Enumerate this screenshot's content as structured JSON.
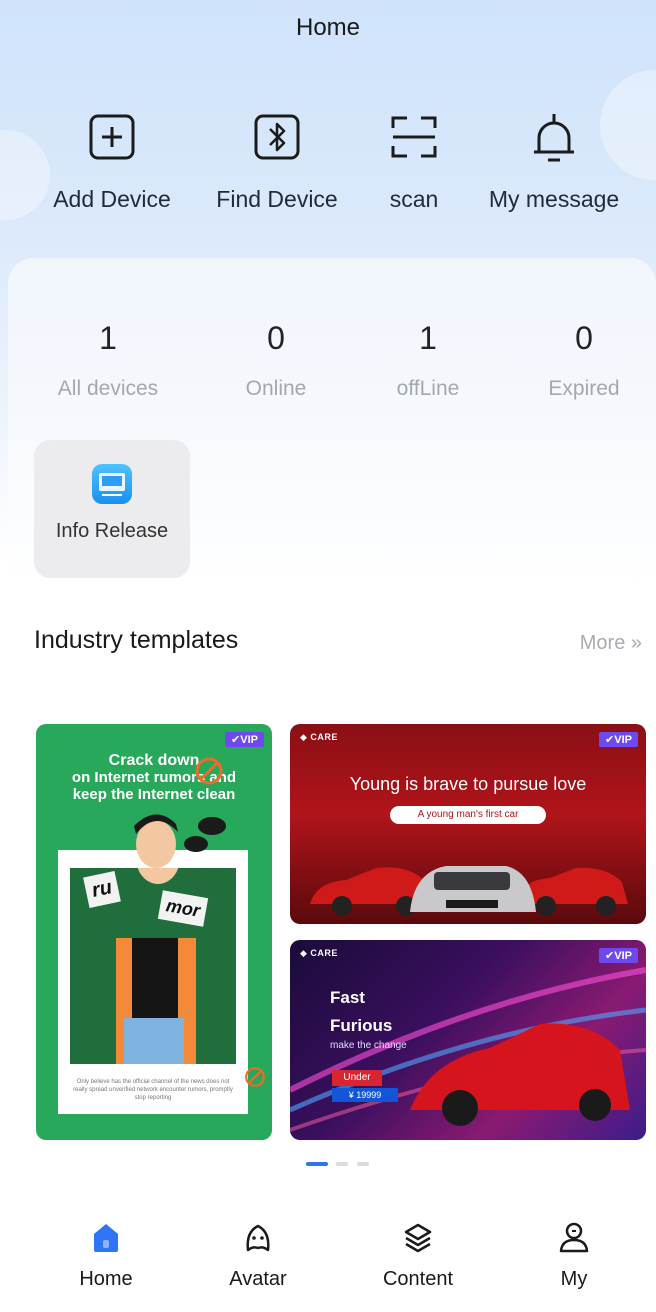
{
  "header": {
    "title": "Home"
  },
  "quick_actions": [
    {
      "label": "Add Device",
      "icon": "add-square-icon"
    },
    {
      "label": "Find Device",
      "icon": "bluetooth-icon"
    },
    {
      "label": "scan",
      "icon": "scan-icon"
    },
    {
      "label": "My message",
      "icon": "bell-icon"
    }
  ],
  "stats": [
    {
      "value": "1",
      "label": "All devices"
    },
    {
      "value": "0",
      "label": "Online"
    },
    {
      "value": "1",
      "label": "offLine"
    },
    {
      "value": "0",
      "label": "Expired"
    }
  ],
  "apps": [
    {
      "label": "Info Release",
      "icon": "info-release-icon"
    }
  ],
  "templates_section": {
    "title": "Industry templates",
    "more_label": "More »",
    "cards": [
      {
        "vip": "✔VIP",
        "headline_1": "Crack down",
        "headline_2": "on Internet rumors and",
        "headline_3": "keep the Internet clean",
        "word_1": "ru",
        "word_2": "mor",
        "small_text": "Only believe has the official channel of the news does not really spread unverified network encounter rumors, promptly stop reporting"
      },
      {
        "vip": "✔VIP",
        "brand": "◆ CARE",
        "headline": "Young is brave to pursue love",
        "pill": "A young man's first car"
      },
      {
        "vip": "✔VIP",
        "brand": "◆ CARE",
        "line_1": "Fast",
        "line_2": "Furious",
        "sub": "make the change",
        "under": "Under",
        "price": "¥ 19999"
      }
    ]
  },
  "carousel": {
    "count": 3,
    "active": 0
  },
  "tabbar": [
    {
      "label": "Home",
      "icon": "home-icon",
      "active": true
    },
    {
      "label": "Avatar",
      "icon": "avatar-icon",
      "active": false
    },
    {
      "label": "Content",
      "icon": "layers-icon",
      "active": false
    },
    {
      "label": "My",
      "icon": "person-icon",
      "active": false
    }
  ],
  "colors": {
    "accent": "#2f74f5",
    "vip": "#6f49f0",
    "header_bg": "#cfe3fb",
    "muted_text": "#a4a8ae"
  }
}
